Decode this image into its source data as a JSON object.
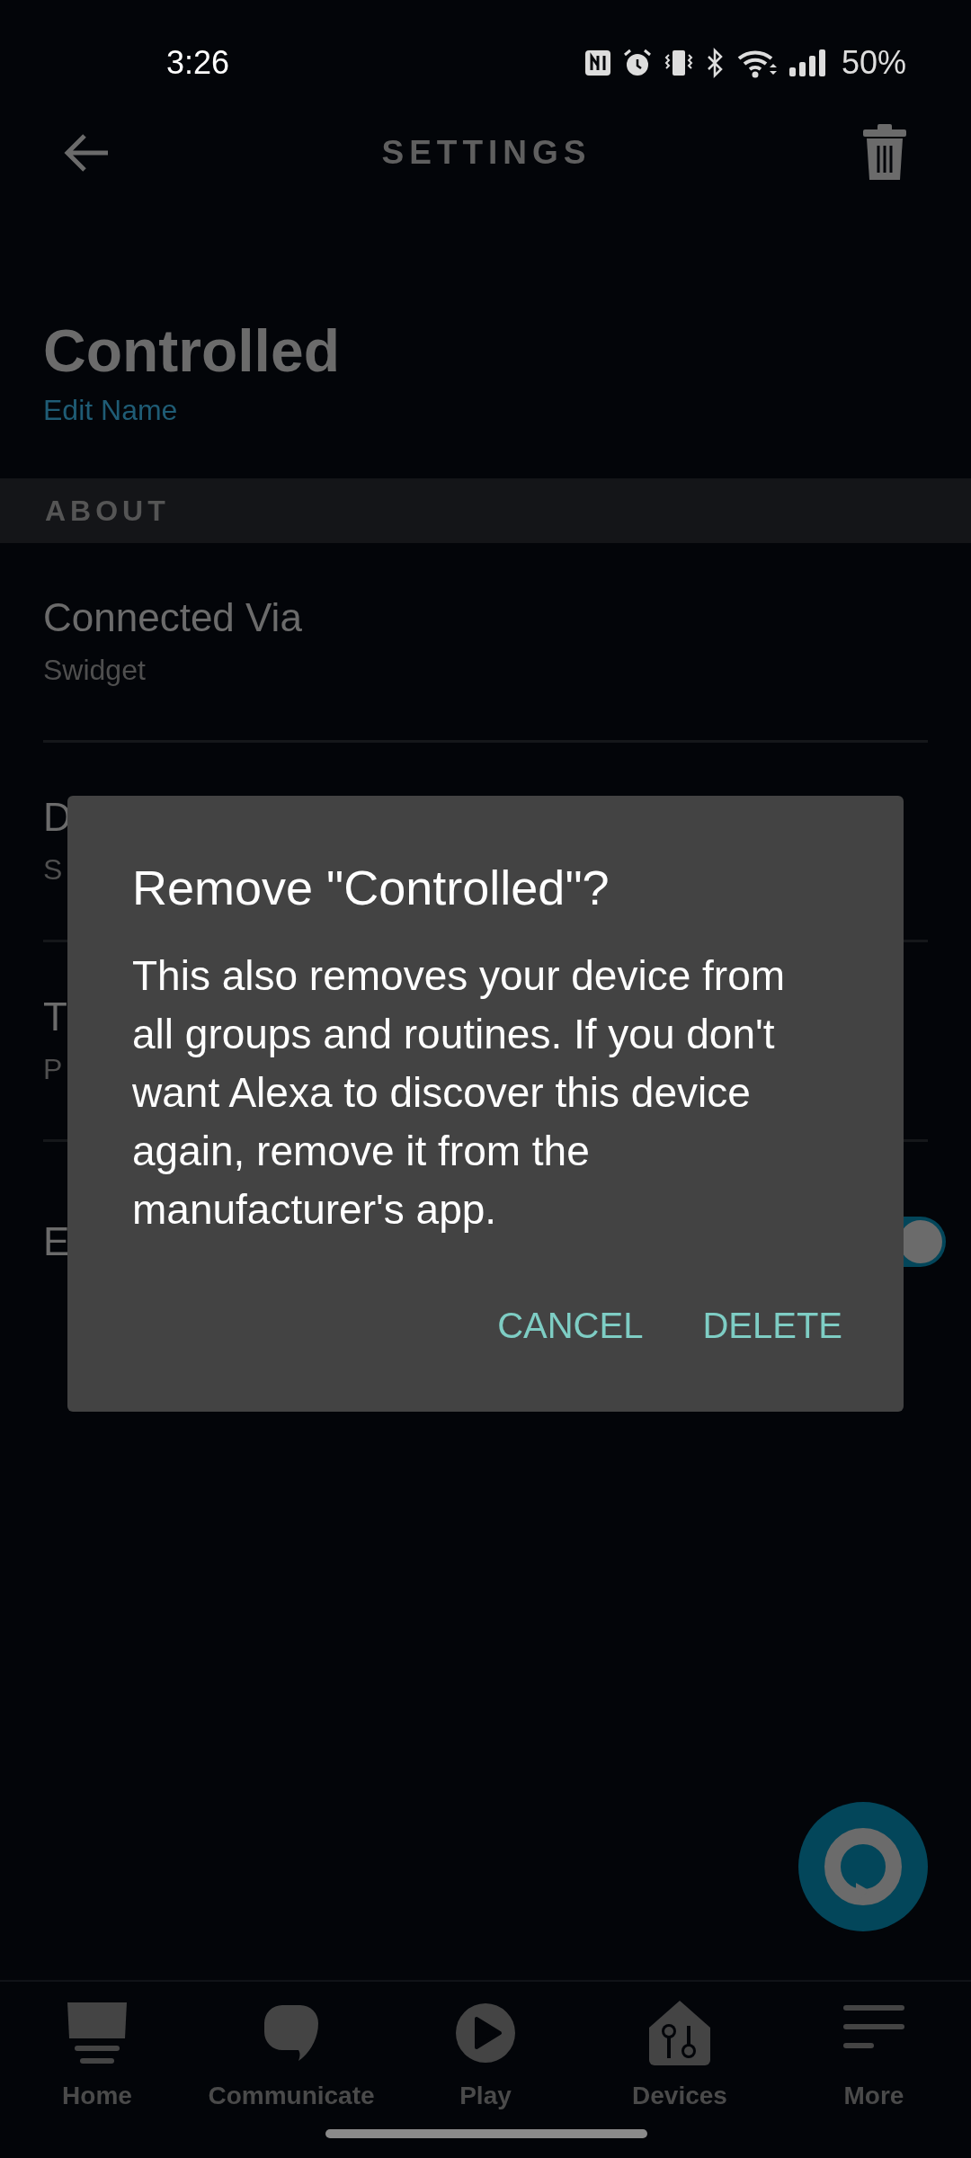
{
  "status_bar": {
    "time": "3:26",
    "battery": "50%"
  },
  "header": {
    "title": "SETTINGS"
  },
  "device": {
    "name": "Controlled",
    "edit_link": "Edit Name"
  },
  "section": {
    "title": "ABOUT"
  },
  "rows": [
    {
      "title": "Connected Via",
      "subtitle": "Swidget"
    },
    {
      "title": "D",
      "subtitle": "S"
    },
    {
      "title": "T",
      "subtitle": "P"
    },
    {
      "title": "E",
      "kind": "toggle",
      "on": true
    }
  ],
  "dialog": {
    "title": "Remove \"Controlled\"?",
    "message": "This also removes your device from all groups and routines. If you don't want Alexa to discover this device again, remove it from the manufacturer's app.",
    "buttons": [
      "CANCEL",
      "DELETE"
    ]
  },
  "nav": [
    {
      "label": "Home"
    },
    {
      "label": "Communicate"
    },
    {
      "label": "Play"
    },
    {
      "label": "Devices"
    },
    {
      "label": "More"
    }
  ]
}
